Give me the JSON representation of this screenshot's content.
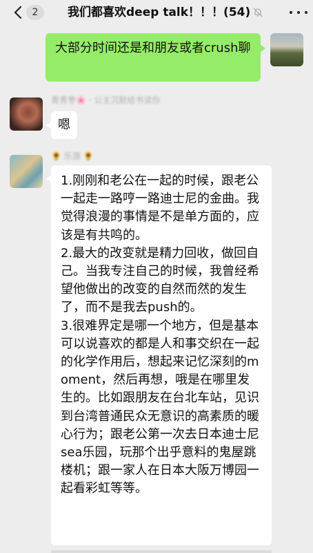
{
  "header": {
    "unread_count": "2",
    "title": "我们都喜欢deep talk！！！(54)"
  },
  "messages": [
    {
      "id": "m1",
      "side": "right",
      "text": "大部分时间还是和朋友或者crush聊"
    },
    {
      "id": "m2",
      "side": "left",
      "sender": "青青枣🌸 · 公主沉默给书读你",
      "text": "嗯"
    },
    {
      "id": "m3",
      "side": "left",
      "sender": "🌻 乐游 🌻",
      "paragraphs": [
        "1.刚刚和老公在一起的时候，跟老公一起走一路哼一路迪士尼的金曲。我觉得浪漫的事情是不是单方面的，应该是有共鸣的。",
        "2.最大的改变就是精力回收，做回自己。当我专注自己的时候，我曾经希望他做出的改变的自然而然的发生了，而不是我去push的。",
        "3.很难界定是哪一个地方，但是基本可以说喜欢的都是人和事交织在一起的化学作用后，想起来记忆深刻的moment，然后再想，哦是在哪里发生的。比如跟朋友在台北车站，见识到台湾普通民众无意识的高素质的暖心行为；跟老公第一次去日本迪士尼sea乐园，玩那个出乎意料的鬼屋跳楼机；跟一家人在日本大阪万博园一起看彩虹等等。"
      ]
    }
  ],
  "colors": {
    "bubble_me": "#95ec69",
    "bubble_other": "#ffffff",
    "background": "#ededed"
  },
  "icons": {
    "back": "chevron-left-icon",
    "mute": "bell-muted-icon",
    "menu": "more-icon"
  }
}
